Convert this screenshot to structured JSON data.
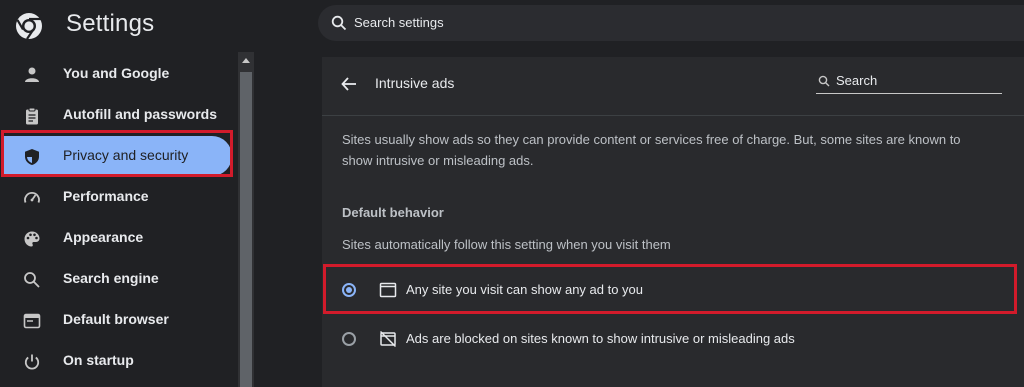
{
  "app": {
    "title": "Settings",
    "search_placeholder": "Search settings"
  },
  "sidebar": {
    "items": [
      {
        "label": "You and Google",
        "icon": "person-icon"
      },
      {
        "label": "Autofill and passwords",
        "icon": "clipboard-icon"
      },
      {
        "label": "Privacy and security",
        "icon": "shield-icon",
        "active": true
      },
      {
        "label": "Performance",
        "icon": "gauge-icon"
      },
      {
        "label": "Appearance",
        "icon": "palette-icon"
      },
      {
        "label": "Search engine",
        "icon": "search-icon"
      },
      {
        "label": "Default browser",
        "icon": "browser-icon"
      },
      {
        "label": "On startup",
        "icon": "power-icon"
      }
    ]
  },
  "page": {
    "title": "Intrusive ads",
    "search_label": "Search",
    "description": "Sites usually show ads so they can provide content or services free of charge. But, some sites are known to show intrusive or misleading ads.",
    "default_behavior_label": "Default behavior",
    "default_behavior_sub": "Sites automatically follow this setting when you visit them",
    "options": [
      {
        "label": "Any site you visit can show any ad to you",
        "checked": true,
        "icon": "window-icon"
      },
      {
        "label": "Ads are blocked on sites known to show intrusive or misleading ads",
        "checked": false,
        "icon": "ads-blocked-icon"
      }
    ]
  },
  "colors": {
    "accent": "#8ab4f8",
    "highlight_box": "#d21b2b",
    "background": "#202124",
    "card": "#292a2d"
  }
}
